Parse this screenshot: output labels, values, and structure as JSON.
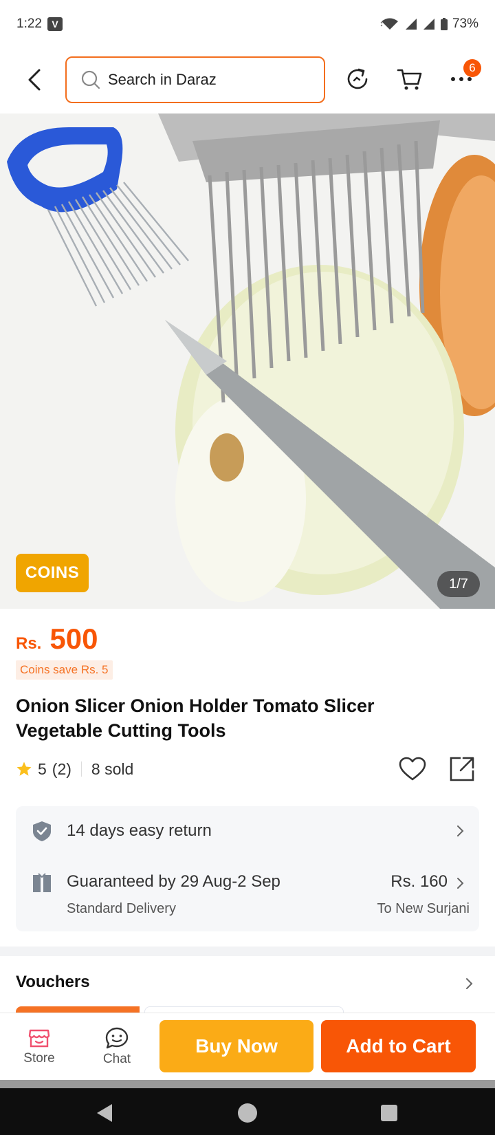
{
  "status_bar": {
    "time": "1:22",
    "app_badge": "V",
    "battery": "73%"
  },
  "header": {
    "search_placeholder": "Search in Daraz",
    "more_badge_count": "6"
  },
  "gallery": {
    "coins_tag": "COINS",
    "page_counter": "1/7"
  },
  "price": {
    "currency": "Rs.",
    "value": "500",
    "coins_save": "Coins save Rs. 5"
  },
  "product": {
    "title": "Onion Slicer Onion Holder Tomato Slicer Vegetable Cutting Tools",
    "rating": "5",
    "rating_count": "(2)",
    "sold": "8 sold"
  },
  "service": {
    "return_text": "14 days easy return",
    "delivery_text": "Guaranteed by 29 Aug-2 Sep",
    "delivery_type": "Standard Delivery",
    "delivery_price": "Rs. 160",
    "delivery_destination": "To New Surjani"
  },
  "vouchers": {
    "title": "Vouchers"
  },
  "bottom_bar": {
    "store_label": "Store",
    "chat_label": "Chat",
    "buy_now_label": "Buy Now",
    "add_to_cart_label": "Add to Cart"
  },
  "colors": {
    "brand_orange": "#f85606",
    "buy_now_yellow": "#fbab16",
    "coins_gold": "#f0a500"
  }
}
